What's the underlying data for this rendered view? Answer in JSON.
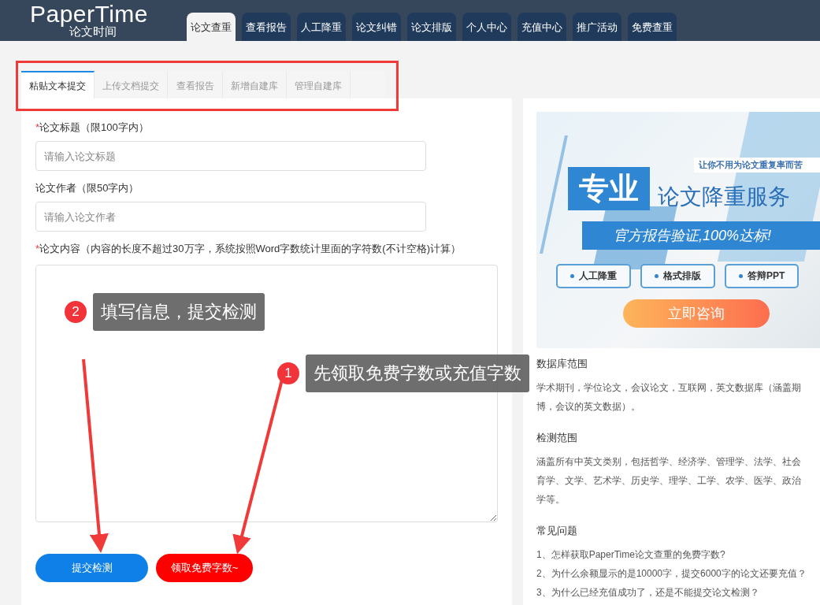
{
  "logo": {
    "text": "PaperTime",
    "subtitle": "论文时间"
  },
  "nav": [
    {
      "label": "论文查重",
      "selected": true
    },
    {
      "label": "查看报告",
      "selected": false
    },
    {
      "label": "人工降重",
      "selected": false
    },
    {
      "label": "论文纠错",
      "selected": false
    },
    {
      "label": "论文排版",
      "selected": false
    },
    {
      "label": "个人中心",
      "selected": false
    },
    {
      "label": "充值中心",
      "selected": false
    },
    {
      "label": "推广活动",
      "selected": false
    },
    {
      "label": "免费查重",
      "selected": false
    }
  ],
  "sub_tabs": [
    {
      "label": "粘贴文本提交",
      "selected": true
    },
    {
      "label": "上传文档提交",
      "selected": false
    },
    {
      "label": "查看报告",
      "selected": false
    },
    {
      "label": "新增自建库",
      "selected": false
    },
    {
      "label": "管理自建库",
      "selected": false
    }
  ],
  "form": {
    "fields": [
      {
        "kind": "input",
        "marker": "*",
        "label": "论文标题（限100字内）",
        "placeholder": "请输入论文标题"
      },
      {
        "kind": "input",
        "label": "论文作者（限50字内）",
        "placeholder": "请输入论文作者"
      },
      {
        "kind": "textarea",
        "marker": "*",
        "label": "论文内容（内容的长度不超过30万字，系统按照Word字数统计里面的字符数(不计空格)计算）"
      }
    ],
    "buttons": [
      {
        "kind": "primary",
        "label": "提交检测"
      },
      {
        "kind": "danger",
        "label": "领取免费字数~"
      }
    ]
  },
  "banner": {
    "tagline": "让你不用为论文重复率而苦",
    "badge": "专业",
    "headline": "论文降重服务",
    "ribbon": "官方报告验证,100%达标!",
    "pills": [
      "人工降重",
      "格式排版",
      "答辩PPT"
    ],
    "button": "立即咨询"
  },
  "info_sections": [
    {
      "heading": "数据库范围",
      "lines": [
        "学术期刊，学位论文，会议论文，互联网，英文数据库（涵盖期",
        "博，会议的英文数据）。"
      ]
    },
    {
      "heading": "检测范围",
      "lines": [
        "涵盖所有中英文类别，包括哲学、经济学、管理学、法学、社会",
        "育学、文学、艺术学、历史学、理学、工学、农学、医学、政治",
        "学等。"
      ]
    },
    {
      "heading": "常见问题",
      "lines": [
        "1、怎样获取PaperTime论文查重的免费字数?",
        "2、为什么余额显示的是10000字，提交6000字的论文还要充值？",
        "3、为什么已经充值成功了，还是不能提交论文检测？"
      ]
    }
  ],
  "callouts": [
    {
      "number": "2",
      "text": "填写信息，提交检测"
    },
    {
      "number": "1",
      "text": "先领取免费字数或充值字数"
    }
  ]
}
